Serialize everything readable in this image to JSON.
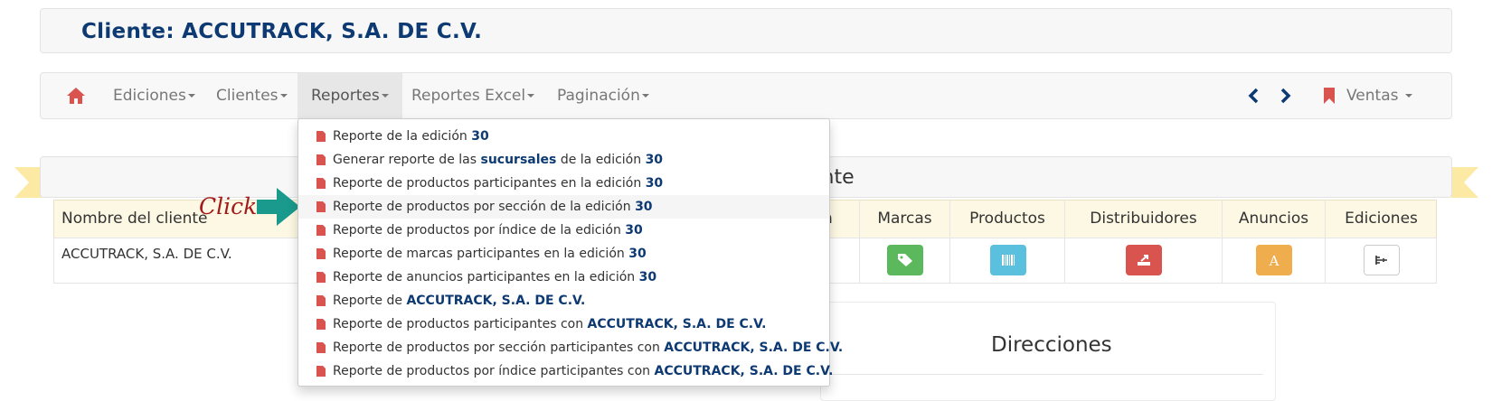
{
  "header": {
    "client_title": "Cliente: ACCUTRACK, S.A. DE C.V."
  },
  "navbar": {
    "home_icon": "home-icon",
    "items": [
      {
        "label": "Ediciones"
      },
      {
        "label": "Clientes"
      },
      {
        "label": "Reportes"
      },
      {
        "label": "Reportes Excel"
      },
      {
        "label": "Paginación"
      }
    ],
    "prev_icon": "chevron-left-icon",
    "next_icon": "chevron-right-icon",
    "ventas_label": "Ventas"
  },
  "ribbon": {
    "title_fragment": "ente"
  },
  "table": {
    "headers": [
      "Nombre del cliente",
      "n",
      "Marcas",
      "Productos",
      "Distribuidores",
      "Anuncios",
      "Ediciones"
    ],
    "row": {
      "name": "ACCUTRACK, S.A. DE C.V."
    },
    "action_icons": [
      "tag-icon",
      "barcode-icon",
      "export-icon",
      "font-icon",
      "sitemap-icon"
    ],
    "action_colors": [
      "#5cb85c",
      "#5bc0de",
      "#d9534f",
      "#f0ad4e",
      "#ffffff"
    ]
  },
  "dropdown": {
    "items": [
      {
        "text": "Reporte de la edición ",
        "bold": "30",
        "tail": ""
      },
      {
        "text": "Generar reporte de las ",
        "bold": "sucursales",
        "tail": " de la edición ",
        "bold2": "30"
      },
      {
        "text": "Reporte de productos participantes en la edición ",
        "bold": "30",
        "tail": ""
      },
      {
        "text": "Reporte de productos por sección de la edición ",
        "bold": "30",
        "tail": ""
      },
      {
        "text": "Reporte de productos por índice de la edición ",
        "bold": "30",
        "tail": ""
      },
      {
        "text": "Reporte de marcas participantes en la edición ",
        "bold": "30",
        "tail": ""
      },
      {
        "text": "Reporte de anuncios participantes en la edición ",
        "bold": "30",
        "tail": ""
      },
      {
        "text": "Reporte de ",
        "bold": "ACCUTRACK, S.A. DE C.V.",
        "tail": ""
      },
      {
        "text": "Reporte de productos participantes con ",
        "bold": "ACCUTRACK, S.A. DE C.V.",
        "tail": ""
      },
      {
        "text": "Reporte de productos por sección participantes con ",
        "bold": "ACCUTRACK, S.A. DE C.V.",
        "tail": ""
      },
      {
        "text": "Reporte de productos por índice participantes con ",
        "bold": "ACCUTRACK, S.A. DE C.V.",
        "tail": ""
      }
    ]
  },
  "annotation": {
    "click_label": "Click"
  },
  "direcciones": {
    "title": "Direcciones"
  }
}
